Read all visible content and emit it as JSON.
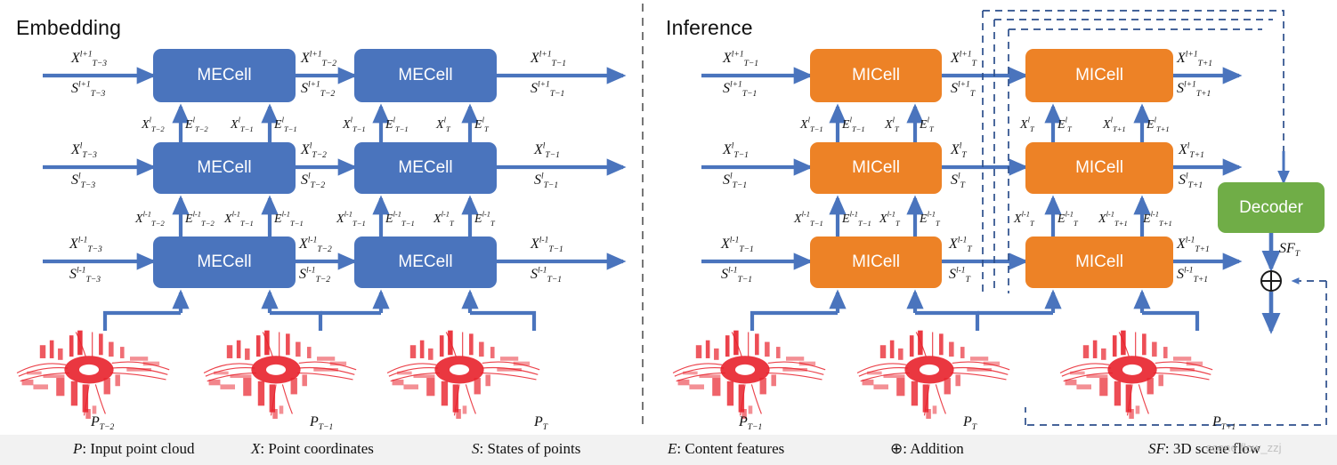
{
  "figure": {
    "sections": [
      {
        "id": "embedding",
        "title": "Embedding"
      },
      {
        "id": "inference",
        "title": "Inference"
      }
    ],
    "cell_labels": {
      "embedding": "MECell",
      "inference": "MICell",
      "decoder": "Decoder"
    },
    "colors": {
      "mecell": "#4a74bd",
      "micell": "#ed8226",
      "decoder": "#70ad47",
      "arrow": "#4a74bd",
      "pointcloud": "#e8212b",
      "legend_bg": "#f2f2f2",
      "text": "#111111"
    }
  },
  "embedding": {
    "title": "Embedding",
    "columns": [
      {
        "col": 1,
        "inputs": {
          "top": {
            "x": "X",
            "x_sup": "l+1",
            "x_sub": "T−3",
            "s": "S",
            "s_sup": "l+1",
            "s_sub": "T−3"
          },
          "mid": {
            "x": "X",
            "x_sup": "l",
            "x_sub": "T−3",
            "s": "S",
            "s_sup": "l",
            "s_sub": "T−3"
          },
          "bottom": {
            "x": "X",
            "x_sup": "l-1",
            "x_sub": "T−3",
            "s": "S",
            "s_sup": "l-1",
            "s_sub": "T−3"
          }
        },
        "cells": [
          "MECell",
          "MECell",
          "MECell"
        ]
      },
      {
        "col": 2,
        "inputs": {
          "top": {
            "x": "X",
            "x_sup": "l+1",
            "x_sub": "T−2",
            "s": "S",
            "s_sup": "l+1",
            "s_sub": "T−2"
          },
          "mid": {
            "x": "X",
            "x_sup": "l",
            "x_sub": "T−2",
            "s": "S",
            "s_sup": "l",
            "s_sub": "T−2"
          },
          "bottom": {
            "x": "X",
            "x_sup": "l-1",
            "x_sub": "T−2",
            "s": "S",
            "s_sup": "l-1",
            "s_sub": "T−2"
          }
        },
        "cells": [
          "MECell",
          "MECell",
          "MECell"
        ]
      }
    ],
    "outputs": {
      "top": {
        "x": "X",
        "x_sup": "l+1",
        "x_sub": "T−1",
        "s": "S",
        "s_sup": "l+1",
        "s_sub": "T−1"
      },
      "mid": {
        "x": "X",
        "x_sup": "l",
        "x_sub": "T−1",
        "s": "S",
        "s_sup": "l",
        "s_sub": "T−1"
      },
      "bottom": {
        "x": "X",
        "x_sup": "l-1",
        "x_sub": "T−1",
        "s": "S",
        "s_sup": "l-1",
        "s_sub": "T−1"
      }
    },
    "vertical_pairs": [
      {
        "row": "upper",
        "pos": 1,
        "x": "X",
        "x_sup": "l",
        "x_sub": "T−2",
        "e": "E",
        "e_sup": "l",
        "e_sub": "T−2"
      },
      {
        "row": "upper",
        "pos": 2,
        "x": "X",
        "x_sup": "l",
        "x_sub": "T−1",
        "e": "E",
        "e_sup": "l",
        "e_sub": "T−1"
      },
      {
        "row": "upper",
        "pos": 3,
        "x": "X",
        "x_sup": "l",
        "x_sub": "T−1",
        "e": "E",
        "e_sup": "l",
        "e_sub": "T−1"
      },
      {
        "row": "upper",
        "pos": 4,
        "x": "X",
        "x_sup": "l",
        "x_sub": "T",
        "e": "E",
        "e_sup": "l",
        "e_sub": "T"
      },
      {
        "row": "lower",
        "pos": 1,
        "x": "X",
        "x_sup": "l-1",
        "x_sub": "T−2",
        "e": "E",
        "e_sup": "l-1",
        "e_sub": "T−2"
      },
      {
        "row": "lower",
        "pos": 2,
        "x": "X",
        "x_sup": "l-1",
        "x_sub": "T−1",
        "e": "E",
        "e_sup": "l-1",
        "e_sub": "T−1"
      },
      {
        "row": "lower",
        "pos": 3,
        "x": "X",
        "x_sup": "l-1",
        "x_sub": "T−1",
        "e": "E",
        "e_sup": "l-1",
        "e_sub": "T−1"
      },
      {
        "row": "lower",
        "pos": 4,
        "x": "X",
        "x_sup": "l-1",
        "x_sub": "T",
        "e": "E",
        "e_sup": "l-1",
        "e_sub": "T"
      }
    ],
    "pointclouds": [
      {
        "label": "P",
        "sub": "T−2"
      },
      {
        "label": "P",
        "sub": "T−1"
      },
      {
        "label": "P",
        "sub": "T"
      }
    ]
  },
  "inference": {
    "title": "Inference",
    "columns": [
      {
        "col": 1,
        "inputs": {
          "top": {
            "x": "X",
            "x_sup": "l+1",
            "x_sub": "T−1",
            "s": "S",
            "s_sup": "l+1",
            "s_sub": "T−1"
          },
          "mid": {
            "x": "X",
            "x_sup": "l",
            "x_sub": "T−1",
            "s": "S",
            "s_sup": "l",
            "s_sub": "T−1"
          },
          "bottom": {
            "x": "X",
            "x_sup": "l-1",
            "x_sub": "T−1",
            "s": "S",
            "s_sup": "l-1",
            "s_sub": "T−1"
          }
        },
        "cells": [
          "MICell",
          "MICell",
          "MICell"
        ]
      },
      {
        "col": 2,
        "inputs": {
          "top": {
            "x": "X",
            "x_sup": "l+1",
            "x_sub": "T",
            "s": "S",
            "s_sup": "l+1",
            "s_sub": "T"
          },
          "mid": {
            "x": "X",
            "x_sup": "l",
            "x_sub": "T",
            "s": "S",
            "s_sup": "l",
            "s_sub": "T"
          },
          "bottom": {
            "x": "X",
            "x_sup": "l-1",
            "x_sub": "T",
            "s": "S",
            "s_sup": "l-1",
            "s_sub": "T"
          }
        },
        "cells": [
          "MICell",
          "MICell",
          "MICell"
        ]
      }
    ],
    "outputs": {
      "top": {
        "x": "X",
        "x_sup": "l+1",
        "x_sub": "T+1",
        "s": "S",
        "s_sup": "l+1",
        "s_sub": "T+1"
      },
      "mid": {
        "x": "X",
        "x_sup": "l",
        "x_sub": "T+1",
        "s": "S",
        "s_sup": "l",
        "s_sub": "T+1"
      },
      "bottom": {
        "x": "X",
        "x_sup": "l-1",
        "x_sub": "T+1",
        "s": "S",
        "s_sup": "l-1",
        "s_sub": "T+1"
      }
    },
    "vertical_pairs": [
      {
        "row": "upper",
        "pos": 1,
        "x": "X",
        "x_sup": "l",
        "x_sub": "T−1",
        "e": "E",
        "e_sup": "l",
        "e_sub": "T−1"
      },
      {
        "row": "upper",
        "pos": 2,
        "x": "X",
        "x_sup": "l",
        "x_sub": "T",
        "e": "E",
        "e_sup": "l",
        "e_sub": "T"
      },
      {
        "row": "upper",
        "pos": 3,
        "x": "X",
        "x_sup": "l",
        "x_sub": "T",
        "e": "E",
        "e_sup": "l",
        "e_sub": "T"
      },
      {
        "row": "upper",
        "pos": 4,
        "x": "X",
        "x_sup": "l",
        "x_sub": "T+1",
        "e": "E",
        "e_sup": "l",
        "e_sub": "T+1"
      },
      {
        "row": "lower",
        "pos": 1,
        "x": "X",
        "x_sup": "l-1",
        "x_sub": "T−1",
        "e": "E",
        "e_sup": "l-1",
        "e_sub": "T−1"
      },
      {
        "row": "lower",
        "pos": 2,
        "x": "X",
        "x_sup": "l-1",
        "x_sub": "T",
        "e": "E",
        "e_sup": "l-1",
        "e_sub": "T"
      },
      {
        "row": "lower",
        "pos": 3,
        "x": "X",
        "x_sup": "l-1",
        "x_sub": "T",
        "e": "E",
        "e_sup": "l-1",
        "e_sub": "T"
      },
      {
        "row": "lower",
        "pos": 4,
        "x": "X",
        "x_sup": "l-1",
        "x_sub": "T+1",
        "e": "E",
        "e_sup": "l-1",
        "e_sub": "T+1"
      }
    ],
    "pointclouds": [
      {
        "label": "P",
        "sub": "T−1"
      },
      {
        "label": "P",
        "sub": "T"
      },
      {
        "label": "P",
        "sub": "T+1"
      }
    ],
    "decoder": {
      "label": "Decoder"
    },
    "decoder_output": {
      "sym": "SF",
      "sub": "T"
    },
    "addition_symbol": "⊕"
  },
  "legend": {
    "items": [
      {
        "sym": "P",
        "text": ": Input point cloud"
      },
      {
        "sym": "X",
        "text": ": Point coordinates"
      },
      {
        "sym": "S",
        "text": ": States of points"
      },
      {
        "sym": "E",
        "text": ": Content features"
      },
      {
        "sym": "⊕",
        "text": ": Addition"
      },
      {
        "sym": "SF",
        "text": ": 3D scene flow"
      }
    ],
    "watermark": "scene flow_zzj"
  }
}
